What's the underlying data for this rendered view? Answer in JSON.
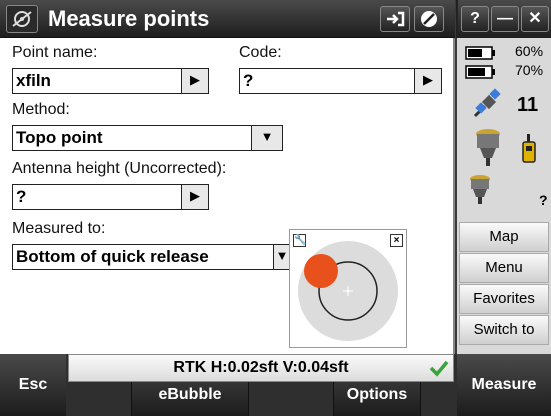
{
  "title": "Measure points",
  "window_buttons": {
    "help": "?",
    "minimize": "—",
    "close": "✕"
  },
  "form": {
    "point_name_label": "Point name:",
    "point_name_value": "xfiln",
    "code_label": "Code:",
    "code_value": "?",
    "method_label": "Method:",
    "method_value": "Topo point",
    "antenna_label": "Antenna height (Uncorrected):",
    "antenna_value": "?",
    "measured_to_label": "Measured to:",
    "measured_to_value": "Bottom of quick release"
  },
  "status_panel": {
    "battery1": "60%",
    "battery2": "70%",
    "satellites": "11",
    "unknown": "?"
  },
  "side_buttons": [
    "Map",
    "Menu",
    "Favorites",
    "Switch to"
  ],
  "status_bar": {
    "text": "RTK H:0.02sft V:0.04sft"
  },
  "bottom_buttons": {
    "esc": "Esc",
    "ebubble": "eBubble",
    "options": "Options",
    "measure": "Measure"
  },
  "colors": {
    "bubble": "#e8501c",
    "check": "#3aa33a"
  }
}
